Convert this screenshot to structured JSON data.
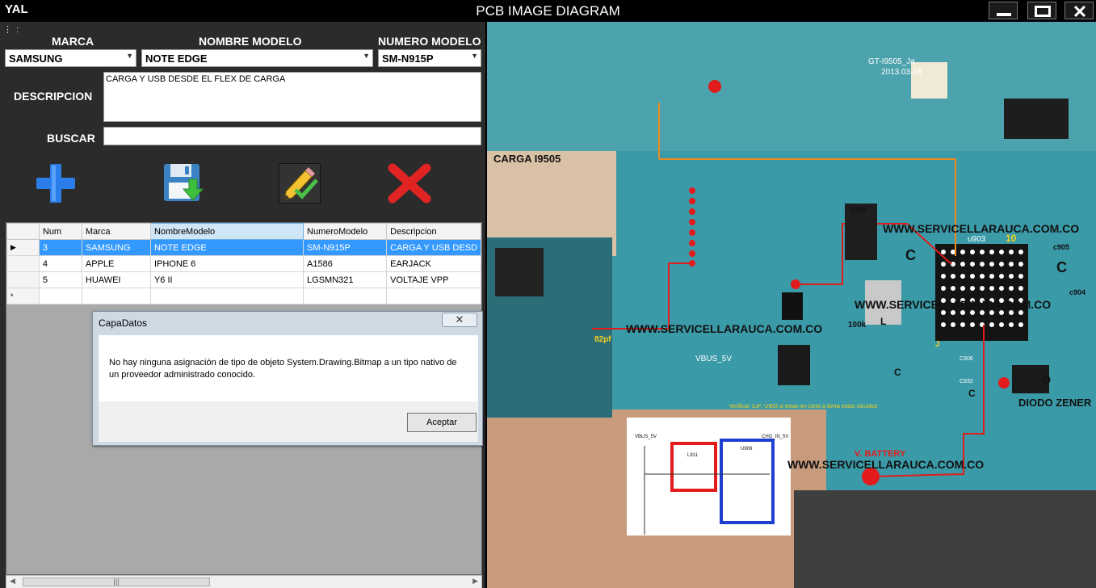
{
  "window": {
    "app_name": "YAL",
    "title": "PCB IMAGE DIAGRAM"
  },
  "form": {
    "labels": {
      "marca": "MARCA",
      "nombre_modelo": "NOMBRE MODELO",
      "numero_modelo": "NUMERO MODELO",
      "descripcion": "DESCRIPCION",
      "buscar": "BUSCAR"
    },
    "marca_value": "SAMSUNG",
    "nombre_modelo_value": "NOTE EDGE",
    "numero_modelo_value": "SM-N915P",
    "descripcion_value": "CARGA Y USB DESDE EL FLEX DE CARGA",
    "buscar_value": ""
  },
  "grid": {
    "columns": [
      "Num",
      "Marca",
      "NombreModelo",
      "NumeroModelo",
      "Descripcion"
    ],
    "rows": [
      [
        "3",
        "SAMSUNG",
        "NOTE EDGE",
        "SM-N915P",
        "CARGA Y USB DESD"
      ],
      [
        "4",
        "APPLE",
        "IPHONE 6",
        "A1586",
        "EARJACK"
      ],
      [
        "5",
        "HUAWEI",
        "Y6 II",
        "LGSMN321",
        "VOLTAJE VPP"
      ]
    ]
  },
  "dialog": {
    "title": "CapaDatos",
    "message": "No hay ninguna asignación de tipo de objeto System.Drawing.Bitmap a un tipo nativo de un proveedor administrado conocido.",
    "ok_label": "Aceptar"
  },
  "pcb_image": {
    "labels": {
      "board_id": "GT-I9505_Ja",
      "date": "2013.03.18",
      "section_title": "CARGA I9505",
      "watermark": "WWW.SERVICELLARAUCA.COM.CO",
      "u906": "u906",
      "u903": "u903",
      "vbus": "VBUS_5V",
      "pf82": "82pf",
      "r100k": "100k",
      "l": "L",
      "c": "C",
      "c905": "c905",
      "c904": "c904",
      "c906": "C906",
      "c932": "C932",
      "d": "D",
      "diodo_zener": "DIODO ZENER",
      "v_battery": "V. BATTERY",
      "note": "Verificar 1uF: U903 si estan en corto a tierra estos circuitos",
      "ten": "10",
      "j": "J",
      "sch_vbus": "VBUS_5V",
      "sch_chg": "CHG_IN_5V",
      "sch_l911": "L911",
      "sch_u906": "U906"
    }
  },
  "colors": {
    "panel_bg": "#2b2b2b",
    "selection": "#3399ff",
    "pcb_green": "#3a9aa8"
  }
}
